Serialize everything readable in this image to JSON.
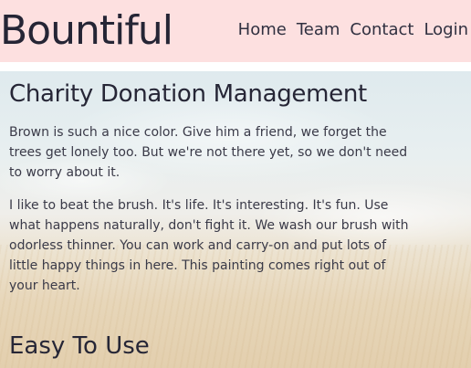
{
  "header": {
    "brand": "Bountiful",
    "nav": [
      "Home",
      "Team",
      "Contact",
      "Login"
    ]
  },
  "main": {
    "heading": "Charity Donation Management",
    "paragraphs": [
      "Brown is such a nice color. Give him a friend, we forget the trees get lonely too. But we're not there yet, so we don't need to worry about it.",
      "I like to beat the brush. It's life. It's interesting. It's fun. Use what happens naturally, don't fight it. We wash our brush with odorless thinner. You can work and carry-on and put lots of little happy things in here. This painting comes right out of your heart."
    ],
    "section_heading": "Easy To Use"
  },
  "colors": {
    "header_bg": "#fde0e0",
    "text": "#2a2a3a"
  }
}
